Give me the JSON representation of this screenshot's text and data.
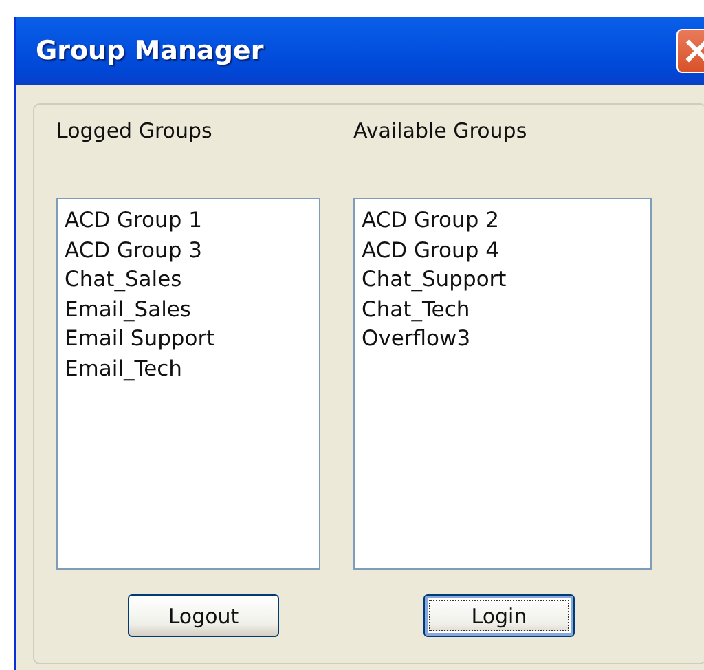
{
  "window": {
    "title": "Group Manager"
  },
  "logged_groups": {
    "label": "Logged Groups",
    "items": [
      "ACD Group 1",
      "ACD Group 3",
      "Chat_Sales",
      "Email_Sales",
      "Email Support",
      "Email_Tech"
    ]
  },
  "available_groups": {
    "label": "Available Groups",
    "items": [
      "ACD Group 2",
      "ACD Group 4",
      "Chat_Support",
      "Chat_Tech",
      "Overflow3"
    ]
  },
  "buttons": [
    {
      "label": "Logout",
      "focused": false
    },
    {
      "label": "Login",
      "focused": true
    }
  ]
}
